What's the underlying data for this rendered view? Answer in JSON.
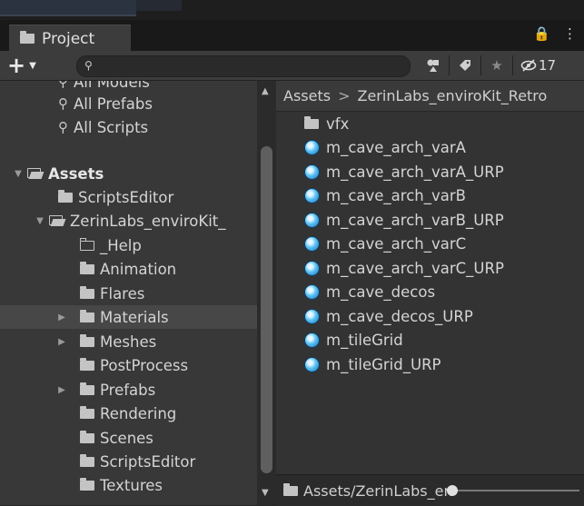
{
  "tab": {
    "label": "Project",
    "lock_icon": "lock-icon",
    "menu_icon": "kebab-menu-icon"
  },
  "toolbar": {
    "create_label": "+",
    "search_placeholder": "",
    "hidden_packages_count": "17",
    "icons": [
      "search-by-type-icon",
      "search-by-label-icon",
      "favorites-star-icon",
      "hidden-packages-icon"
    ]
  },
  "tree": {
    "partial_top": "All Models",
    "items": [
      {
        "label": "All Prefabs",
        "kind": "search",
        "depth": 1
      },
      {
        "label": "All Scripts",
        "kind": "search",
        "depth": 1
      },
      {
        "label": "Assets",
        "kind": "folder-open",
        "depth": 0,
        "expanded": true,
        "bold": true
      },
      {
        "label": "ScriptsEditor",
        "kind": "folder",
        "depth": 1
      },
      {
        "label": "ZerinLabs_enviroKit_",
        "kind": "folder-open",
        "depth": 1,
        "expanded": true
      },
      {
        "label": "_Help",
        "kind": "folder-outline",
        "depth": 2
      },
      {
        "label": "Animation",
        "kind": "folder",
        "depth": 2
      },
      {
        "label": "Flares",
        "kind": "folder",
        "depth": 2
      },
      {
        "label": "Materials",
        "kind": "folder",
        "depth": 2,
        "collapsed": true,
        "selected": true
      },
      {
        "label": "Meshes",
        "kind": "folder",
        "depth": 2,
        "collapsed": true
      },
      {
        "label": "PostProcess",
        "kind": "folder",
        "depth": 2
      },
      {
        "label": "Prefabs",
        "kind": "folder",
        "depth": 2,
        "collapsed": true
      },
      {
        "label": "Rendering",
        "kind": "folder",
        "depth": 2
      },
      {
        "label": "Scenes",
        "kind": "folder",
        "depth": 2
      },
      {
        "label": "ScriptsEditor",
        "kind": "folder",
        "depth": 2
      },
      {
        "label": "Textures",
        "kind": "folder",
        "depth": 2
      }
    ]
  },
  "breadcrumb": {
    "root": "Assets",
    "separator": ">",
    "current": "ZerinLabs_enviroKit_Retro"
  },
  "assets": [
    {
      "label": "vfx",
      "kind": "folder"
    },
    {
      "label": "m_cave_arch_varA",
      "kind": "material"
    },
    {
      "label": "m_cave_arch_varA_URP",
      "kind": "material"
    },
    {
      "label": "m_cave_arch_varB",
      "kind": "material"
    },
    {
      "label": "m_cave_arch_varB_URP",
      "kind": "material"
    },
    {
      "label": "m_cave_arch_varC",
      "kind": "material"
    },
    {
      "label": "m_cave_arch_varC_URP",
      "kind": "material"
    },
    {
      "label": "m_cave_decos",
      "kind": "material"
    },
    {
      "label": "m_cave_decos_URP",
      "kind": "material"
    },
    {
      "label": "m_tileGrid",
      "kind": "material"
    },
    {
      "label": "m_tileGrid_URP",
      "kind": "material"
    }
  ],
  "footer": {
    "path": "Assets/ZerinLabs_en",
    "zoom_slider": 0.0
  },
  "colors": {
    "panel_bg": "#383838",
    "selected_row": "#474747",
    "material_icon": "#5bc4f5"
  }
}
